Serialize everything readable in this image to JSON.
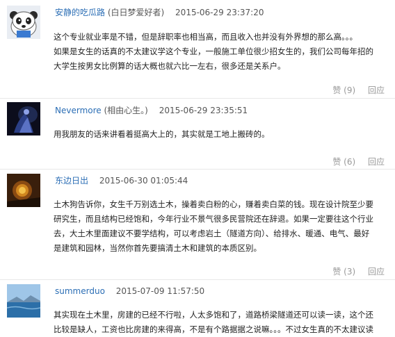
{
  "comments": [
    {
      "username": "安静的吃瓜路",
      "role": "(白日梦爱好者)",
      "time": "2015-06-29 23:37:20",
      "lines": [
        "这个专业就业率是不错，但是辞职率也相当高，而且收入也并没有外界想的那么高。。。",
        "如果是女生的话真的不太建议学这个专业，一般施工单位很少招女生的，我们公司每年招的",
        "大学生按男女比例算的话大概也就六比一左右，很多还是关系户。"
      ],
      "like": "赞 (9)",
      "reply": "回应"
    },
    {
      "username": "Nevermore",
      "role": "(相由心生。)",
      "time": "2015-06-29 23:35:51",
      "lines": [
        "用我朋友的话来讲看着挺高大上的，其实就是工地上搬砖的。"
      ],
      "like": "赞 (6)",
      "reply": "回应"
    },
    {
      "username": "东边日出",
      "role": "",
      "time": "2015-06-30 01:05:44",
      "lines": [
        "土木狗告诉你，女生千万别选土木，操着卖白粉的心，赚着卖白菜的钱。现在设计院至少要",
        "研究生，而且结构已经饱和，今年行业不景气很多民营院还在辞退。如果一定要往这个行业",
        "去，大土木里面建议不要学结构，可以考虑岩土（隧道方向）、给排水、暖通、电气、最好",
        "是建筑和园林，当然你首先要搞清土木和建筑的本质区别。"
      ],
      "like": "赞 (3)",
      "reply": "回应"
    },
    {
      "username": "summerduo",
      "role": "",
      "time": "2015-07-09 11:57:50",
      "lines": [
        "其实现在土木里，房建的已经不行啦，人太多饱和了，道路桥梁隧道还可以读一读，这个还",
        "比较是缺人，工资也比房建的来得高，不是有个路据据之说嘛。。。不过女生真的不太建议读"
      ],
      "like": "",
      "reply": ""
    }
  ]
}
